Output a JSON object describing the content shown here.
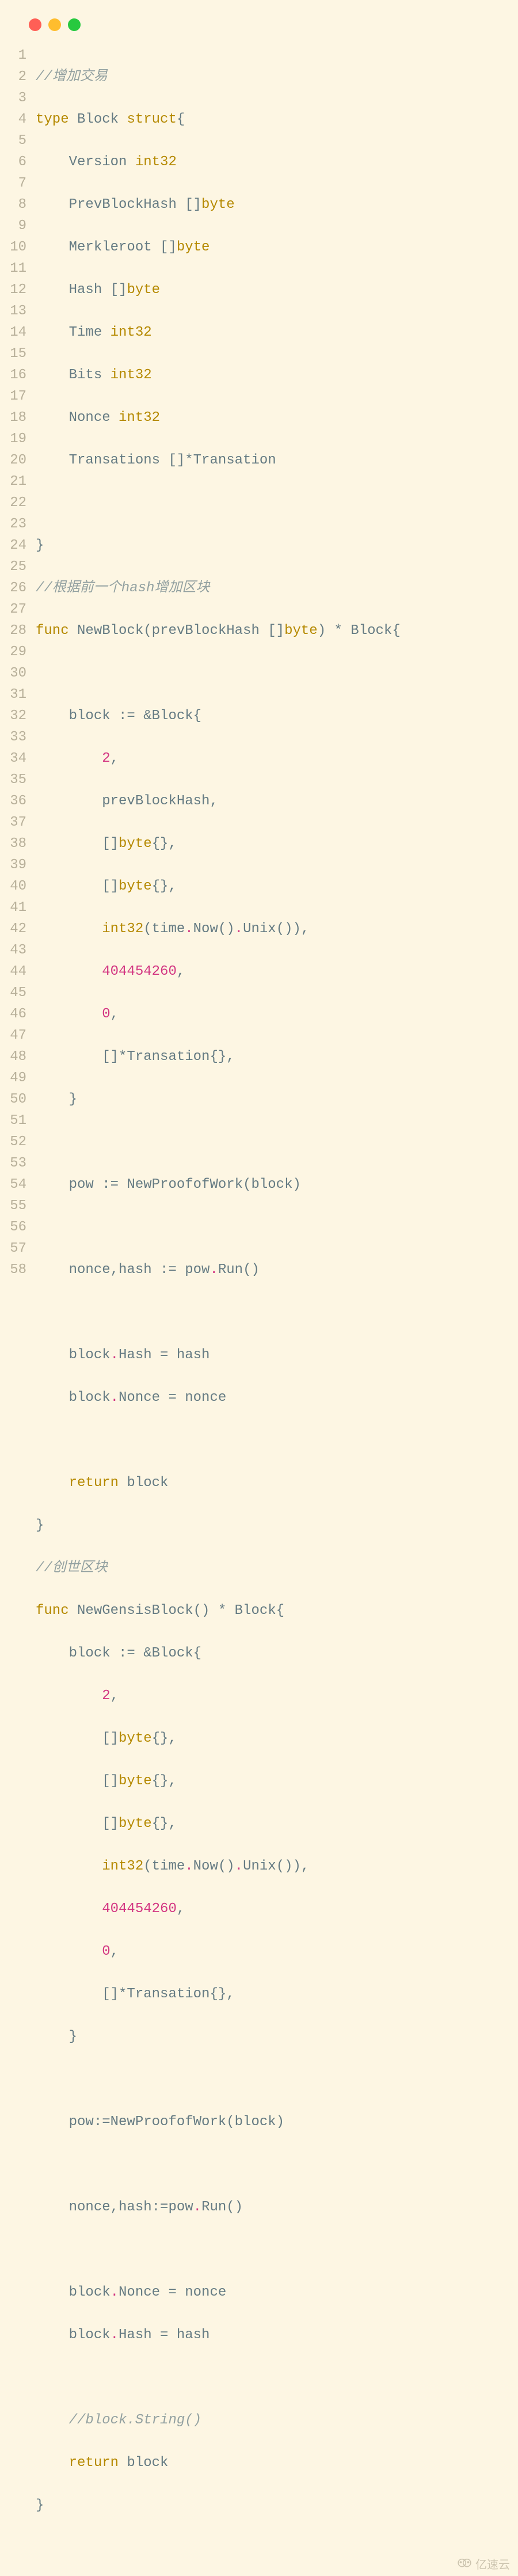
{
  "editor": {
    "traffic_lights": {
      "red": "#ff5f56",
      "yellow": "#ffbd2e",
      "green": "#27c93f"
    },
    "line_count": 58,
    "lines": {
      "l1_comment": "//增加交易",
      "l2_type": "type",
      "l2_name": " Block ",
      "l2_struct": "struct",
      "l2_brace": "{",
      "l3_pad": "    ",
      "l3_field": "Version ",
      "l3_type": "int32",
      "l4_pad": "    ",
      "l4_field": "PrevBlockHash []",
      "l4_type": "byte",
      "l5_pad": "    ",
      "l5_field": "Merkleroot []",
      "l5_type": "byte",
      "l6_pad": "    ",
      "l6_field": "Hash []",
      "l6_type": "byte",
      "l7_pad": "    ",
      "l7_field": "Time ",
      "l7_type": "int32",
      "l8_pad": "    ",
      "l8_field": "Bits ",
      "l8_type": "int32",
      "l9_pad": "    ",
      "l9_field": "Nonce ",
      "l9_type": "int32",
      "l10_pad": "    ",
      "l10_field": "Transations []*Transation",
      "l12": "}",
      "l13_comment": "//根据前一个hash增加区块",
      "l14_func": "func",
      "l14_sig1": " NewBlock(prevBlockHash []",
      "l14_byte": "byte",
      "l14_sig2": ") * Block{",
      "l16_pad": "    ",
      "l16_txt": "block := &Block{",
      "l17_pad": "        ",
      "l17_num": "2",
      "l17_c": ",",
      "l18_pad": "        ",
      "l18_txt": "prevBlockHash,",
      "l19_pad": "        ",
      "l19_a": "[]",
      "l19_byte": "byte",
      "l19_b": "{},",
      "l20_pad": "        ",
      "l20_a": "[]",
      "l20_byte": "byte",
      "l20_b": "{},",
      "l21_pad": "        ",
      "l21_int32": "int32",
      "l21_a": "(time",
      "l21_dot": ".",
      "l21_b": "Now()",
      "l21_dot2": ".",
      "l21_c": "Unix()),",
      "l22_pad": "        ",
      "l22_num": "404454260",
      "l22_c": ",",
      "l23_pad": "        ",
      "l23_num": "0",
      "l23_c": ",",
      "l24_pad": "        ",
      "l24_txt": "[]*Transation{},",
      "l25_pad": "    ",
      "l25_txt": "}",
      "l27_pad": "    ",
      "l27_txt": "pow := NewProofofWork(block)",
      "l29_pad": "    ",
      "l29_a": "nonce,hash := pow",
      "l29_dot": ".",
      "l29_b": "Run()",
      "l31_pad": "    ",
      "l31_a": "block",
      "l31_dot": ".",
      "l31_b": "Hash = hash",
      "l32_pad": "    ",
      "l32_a": "block",
      "l32_dot": ".",
      "l32_b": "Nonce = nonce",
      "l34_pad": "    ",
      "l34_ret": "return",
      "l34_txt": " block",
      "l35_txt": "}",
      "l36_comment": "//创世区块",
      "l37_func": "func",
      "l37_sig": " NewGensisBlock() * Block{",
      "l38_pad": "    ",
      "l38_txt": "block := &Block{",
      "l39_pad": "        ",
      "l39_num": "2",
      "l39_c": ",",
      "l40_pad": "        ",
      "l40_a": "[]",
      "l40_byte": "byte",
      "l40_b": "{},",
      "l41_pad": "        ",
      "l41_a": "[]",
      "l41_byte": "byte",
      "l41_b": "{},",
      "l42_pad": "        ",
      "l42_a": "[]",
      "l42_byte": "byte",
      "l42_b": "{},",
      "l43_pad": "        ",
      "l43_int32": "int32",
      "l43_a": "(time",
      "l43_dot": ".",
      "l43_b": "Now()",
      "l43_dot2": ".",
      "l43_c": "Unix()),",
      "l44_pad": "        ",
      "l44_num": "404454260",
      "l44_c": ",",
      "l45_pad": "        ",
      "l45_num": "0",
      "l45_c": ",",
      "l46_pad": "        ",
      "l46_txt": "[]*Transation{},",
      "l47_pad": "    ",
      "l47_txt": "}",
      "l49_pad": "    ",
      "l49_txt": "pow:=NewProofofWork(block)",
      "l51_pad": "    ",
      "l51_a": "nonce,hash:=pow",
      "l51_dot": ".",
      "l51_b": "Run()",
      "l53_pad": "    ",
      "l53_a": "block",
      "l53_dot": ".",
      "l53_b": "Nonce = nonce",
      "l54_pad": "    ",
      "l54_a": "block",
      "l54_dot": ".",
      "l54_b": "Hash = hash",
      "l56_pad": "    ",
      "l56_comment": "//block.String()",
      "l57_pad": "    ",
      "l57_ret": "return",
      "l57_txt": " block",
      "l58_txt": "}"
    }
  },
  "watermark": {
    "text": "亿速云"
  }
}
